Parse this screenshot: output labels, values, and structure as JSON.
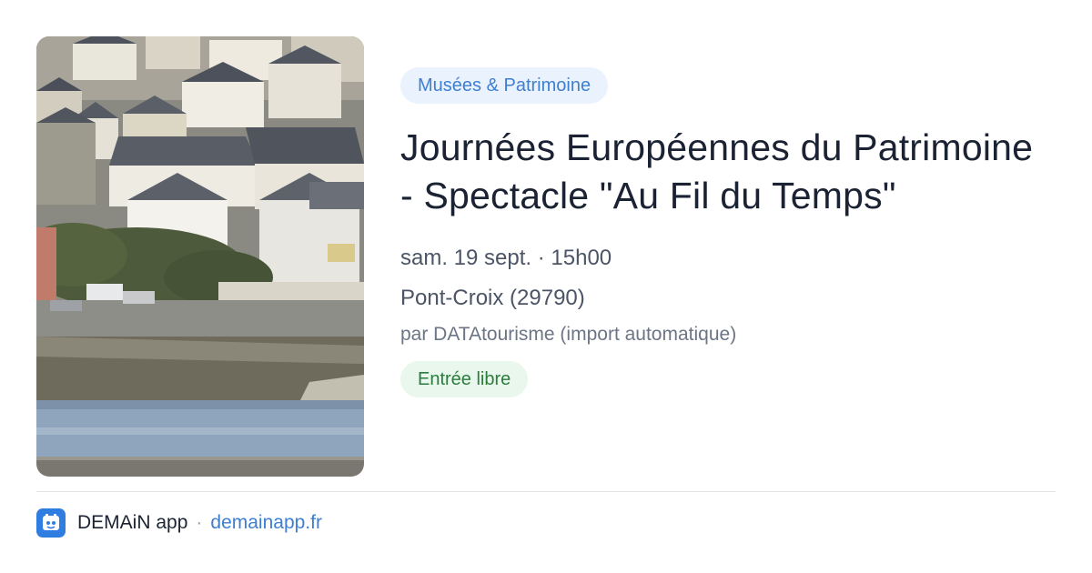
{
  "event": {
    "category": "Musées & Patrimoine",
    "title": "Journées Européennes du Patrimoine - Spectacle \"Au Fil du Temps\"",
    "date_time": "sam. 19 sept. · 15h00",
    "location": "Pont-Croix (29790)",
    "author": "par DATAtourisme (import automatique)",
    "price": "Entrée libre"
  },
  "footer": {
    "app_name": "DEMAiN app",
    "separator": "·",
    "link": "demainapp.fr"
  },
  "icons": {
    "app_logo": "demain-app-logo-icon"
  },
  "colors": {
    "category_chip_bg": "#eaf2fd",
    "category_chip_text": "#3f7fd1",
    "price_chip_bg": "#e9f7ec",
    "price_chip_text": "#2a7d3c",
    "link": "#3f7fd1",
    "logo_bg": "#2f7de1"
  }
}
